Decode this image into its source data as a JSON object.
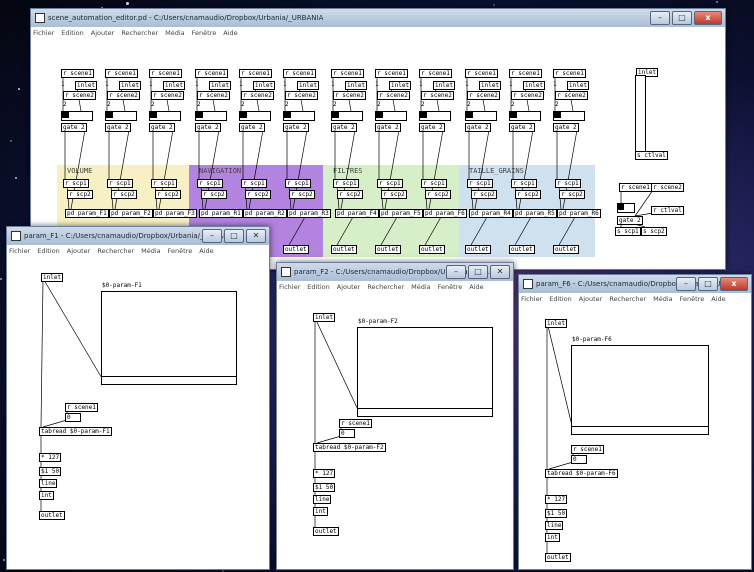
{
  "colors": {
    "volume": "#f7f0c4",
    "navigation": "#b383e0",
    "filtres": "#d6efc8",
    "taille": "#cfe0ef"
  },
  "main": {
    "title": "scene_automation_editor.pd  - C:/Users/cnamaudio/Dropbox/Urbania/_URBANIA",
    "menu": [
      "Fichier",
      "Edition",
      "Ajouter",
      "Rechercher",
      "Média",
      "Fenêtre",
      "Aide"
    ],
    "groups": {
      "volume": "VOLUME",
      "navigation": "NAVIGATION",
      "filtres": "FILTRES",
      "taille": "TAILLE_GRAINS"
    },
    "r_scene1": "r scene1",
    "r_scene2": "r scene2",
    "inlet": "inlet",
    "gate": "gate 2",
    "one": "1",
    "two": "2",
    "s_scp1": "s scp1",
    "s_scp2": "s scp2",
    "r_scp1": "r scp1",
    "r_scp2": "r scp2",
    "outlet": "outlet",
    "pd_params": [
      "pd param_F1",
      "pd param_F2",
      "pd param_F3",
      "pd param_R1",
      "pd param_R2",
      "pd param_R3",
      "pd param_F4",
      "pd param_F5",
      "pd param_F6",
      "pd param_R4",
      "pd param_R5",
      "pd param_R6"
    ],
    "ctl": {
      "inlet": "inlet",
      "s_ctlval": "s ctlval",
      "r_scene1": "r scene1",
      "r_scene2": "r scene2",
      "r_ctlval": "r ctlval",
      "gate": "gate 2",
      "s_scp1": "s scp1",
      "s_scp2": "s scp2"
    }
  },
  "win_f1": {
    "title": "param_F1 - C:/Users/cnamaudio/Dropbox/Urbania/_URBANIA",
    "menu": [
      "Fichier",
      "Edition",
      "Ajouter",
      "Rechercher",
      "Média",
      "Fenêtre",
      "Aide"
    ],
    "inlet": "inlet",
    "array_name": "$0-param-F1",
    "r_scene1": "r scene1",
    "zero": "0",
    "tabread": "tabread $0-param-F1",
    "mult": "* 127",
    "msg": "$1 50",
    "line": "line",
    "int": "int",
    "outlet": "outlet"
  },
  "win_f2": {
    "title": "param_F2 - C:/Users/cnamaudio/Dropbox/Urbania/_UR...",
    "menu": [
      "Fichier",
      "Edition",
      "Ajouter",
      "Rechercher",
      "Média",
      "Fenêtre",
      "Aide"
    ],
    "inlet": "inlet",
    "array_name": "$0-param-F2",
    "r_scene1": "r scene1",
    "zero": "0",
    "tabread": "tabread $0-param-F2",
    "mult": "* 127",
    "msg": "$1 50",
    "line": "line",
    "int": "int",
    "outlet": "outlet"
  },
  "win_f6": {
    "title": "param_F6 - C:/Users/cnamaudio/Dropbox/Urbania/_URB...",
    "menu": [
      "Fichier",
      "Edition",
      "Ajouter",
      "Rechercher",
      "Média",
      "Fenêtre",
      "Aide"
    ],
    "inlet": "inlet",
    "array_name": "$0-param-F6",
    "r_scene1": "r scene1",
    "zero": "0",
    "tabread": "tabread $0-param-F6",
    "mult": "* 127",
    "msg": "$1 50",
    "line": "line",
    "int": "int",
    "outlet": "outlet"
  }
}
